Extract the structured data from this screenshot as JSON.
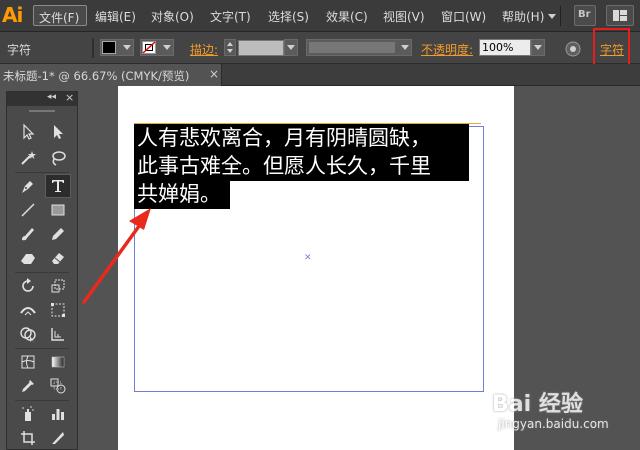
{
  "app": {
    "logo": "Ai"
  },
  "menu": [
    "文件(F)",
    "编辑(E)",
    "对象(O)",
    "文字(T)",
    "选择(S)",
    "效果(C)",
    "视图(V)",
    "窗口(W)",
    "帮助(H)"
  ],
  "menubar_buttons": {
    "bridge": "Br"
  },
  "controlbar": {
    "selection_label": "字符",
    "stroke_label": "描边:",
    "opacity_label": "不透明度:",
    "opacity_value": "100%",
    "character_link": "字符"
  },
  "document_tab": {
    "title": "未标题-1* @ 66.67% (CMYK/预览)",
    "close": "×"
  },
  "toolpanel": {
    "collapse": "◂◂",
    "close": "×"
  },
  "canvas_text": {
    "lines": [
      "人有悲欢离合，月有阴晴圆缺，",
      "此事古难全。但愿人长久，千里",
      "共婵娟。"
    ]
  },
  "watermark": {
    "logo": "Bai 经验",
    "url": "jingyan.baidu.com"
  },
  "colors": {
    "highlight_box": "#e81e1e",
    "arrow": "#e8291c",
    "accent": "#f19b2c"
  }
}
